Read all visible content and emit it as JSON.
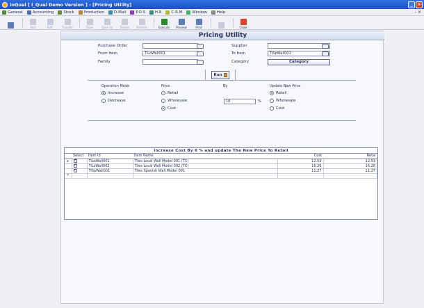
{
  "window": {
    "title": "inQual [ I_Qual Demo Version ] - [Pricing Utility]"
  },
  "menu": [
    {
      "label": "General",
      "icon": "general-icon",
      "color": "#4b8b3b"
    },
    {
      "label": "Accounting",
      "icon": "accounting-icon",
      "color": "#4b6bb8"
    },
    {
      "label": "Stock",
      "icon": "stock-icon",
      "color": "#6b8b3b"
    },
    {
      "label": "Production",
      "icon": "production-icon",
      "color": "#b8863b"
    },
    {
      "label": "D-Mail",
      "icon": "dmail-icon",
      "color": "#3b8bb8"
    },
    {
      "label": "P.O.S",
      "icon": "pos-icon",
      "color": "#8b3bb8"
    },
    {
      "label": "H.R",
      "icon": "hr-icon",
      "color": "#3b8b8b"
    },
    {
      "label": "C.R.M",
      "icon": "crm-icon",
      "color": "#b8b83b"
    },
    {
      "label": "Window",
      "icon": "window-icon",
      "color": "#3bb86b"
    },
    {
      "label": "Help",
      "icon": "help-icon",
      "color": "#888888"
    }
  ],
  "toolbar": [
    {
      "label": "",
      "icon": "lookup-icon",
      "enabled": true
    },
    {
      "label": "Add",
      "icon": "add-icon",
      "enabled": false
    },
    {
      "label": "Edit",
      "icon": "edit-icon",
      "enabled": false
    },
    {
      "label": "Transfer",
      "icon": "transfer-icon",
      "enabled": false
    },
    {
      "label": "Save",
      "icon": "save-icon",
      "enabled": false
    },
    {
      "label": "Save as",
      "icon": "save-as-icon",
      "enabled": false
    },
    {
      "label": "Delete",
      "icon": "delete-icon",
      "enabled": false
    },
    {
      "label": "Refresh",
      "icon": "refresh-icon",
      "enabled": false
    },
    {
      "label": "Execute",
      "icon": "execute-icon",
      "enabled": true
    },
    {
      "label": "Preview",
      "icon": "preview-icon",
      "enabled": true
    },
    {
      "label": "Print",
      "icon": "print-icon",
      "enabled": true
    },
    {
      "label": "",
      "icon": "search-icon",
      "enabled": false
    },
    {
      "label": "Close",
      "icon": "close-icon",
      "enabled": true
    }
  ],
  "page": {
    "title": "Pricing Utility"
  },
  "filters": {
    "purchase_order_label": "Purchase Order",
    "purchase_order_value": "",
    "supplier_label": "Supplier",
    "supplier_value": "",
    "from_item_label": "From Item",
    "from_item_value": "TiLoWall001",
    "to_item_label": "To Item",
    "to_item_value": "TiSpWall001",
    "family_label": "Family",
    "family_value": "",
    "category_label": "Category",
    "category_button": "Category",
    "run_button": "Run"
  },
  "options": {
    "operation_mode": {
      "title": "Operation Mode",
      "options": [
        "Increase",
        "Decrease"
      ],
      "selected": "Increase"
    },
    "price": {
      "title": "Price",
      "options": [
        "Retail",
        "Wholesale",
        "Cost"
      ],
      "selected": "Cost"
    },
    "by": {
      "title": "By",
      "value": "10",
      "unit": "%"
    },
    "update_new_price": {
      "title": "Update New Price",
      "options": [
        "Retail",
        "Wholesale",
        "Cost"
      ],
      "selected": "Retail"
    }
  },
  "grid": {
    "caption": "Increase  Cost  By 0 %  and update The New  Price To Retail",
    "columns": [
      "Select",
      "Item Id",
      "Item Name",
      "Cost",
      "Retai"
    ],
    "rows": [
      {
        "selected": true,
        "current": true,
        "item_id": "TiLoWall001",
        "item_name": "Tiles Local Wall Model 001 (TX)",
        "cost": "12.53",
        "retail": "12.53"
      },
      {
        "selected": true,
        "current": false,
        "item_id": "TiLoWall002",
        "item_name": "Tiles Local Wall Model 002 (TX)",
        "cost": "16.26",
        "retail": "16.26"
      },
      {
        "selected": true,
        "current": false,
        "item_id": "TiSpWall001",
        "item_name": "Tiles Spanish Wall Model 001",
        "cost": "11.27",
        "retail": "11.27"
      }
    ]
  }
}
